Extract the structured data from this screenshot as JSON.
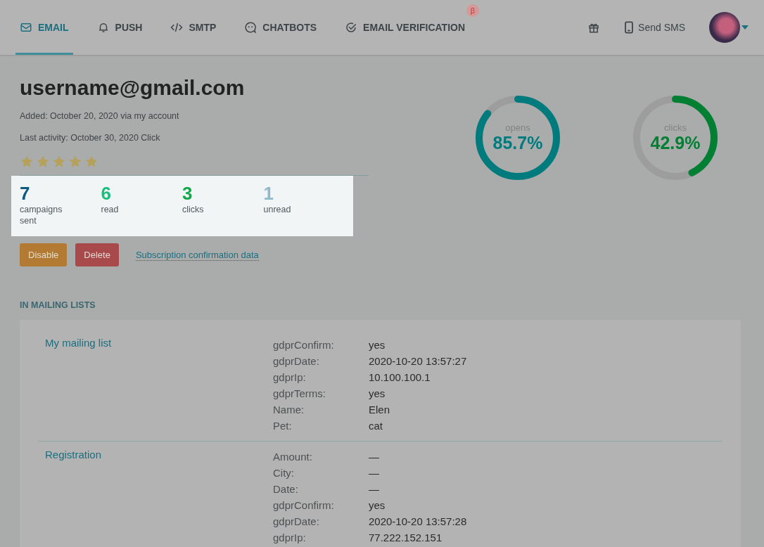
{
  "nav": {
    "tabs": [
      {
        "label": "EMAIL",
        "kind": "mail",
        "selected": true
      },
      {
        "label": "PUSH",
        "kind": "bell",
        "selected": false
      },
      {
        "label": "SMTP",
        "kind": "code",
        "selected": false
      },
      {
        "label": "CHATBOTS",
        "kind": "chat",
        "selected": false
      },
      {
        "label": "EMAIL VERIFICATION",
        "kind": "check",
        "selected": false,
        "badge": "β"
      }
    ],
    "send_sms": "Send SMS"
  },
  "contact": {
    "email": "username@gmail.com",
    "added": "Added: October 20, 2020 via my account",
    "last_activity": "Last activity: October 30, 2020 Click",
    "stars": 5
  },
  "stats": [
    {
      "value": "7",
      "label": "campaigns sent",
      "color": "#0b5a82"
    },
    {
      "value": "6",
      "label": "read",
      "color": "#17c07a"
    },
    {
      "value": "3",
      "label": "clicks",
      "color": "#12a84a"
    },
    {
      "value": "1",
      "label": "unread",
      "color": "#8fb8c8"
    }
  ],
  "actions": {
    "disable": "Disable",
    "delete": "Delete",
    "link": "Subscription confirmation data"
  },
  "gauges": [
    {
      "label": "opens",
      "value": "85.7%",
      "level": 0.857,
      "color": "#007b7d"
    },
    {
      "label": "clicks",
      "value": "42.9%",
      "level": 0.429,
      "color": "#017f33"
    }
  ],
  "mailing_lists": {
    "heading": "IN MAILING LISTS",
    "lists": [
      {
        "name": "My mailing list",
        "fields": [
          [
            "gdprConfirm:",
            "yes"
          ],
          [
            "gdprDate:",
            "2020-10-20 13:57:27"
          ],
          [
            "gdprIp:",
            "10.100.100.1"
          ],
          [
            "gdprTerms:",
            "yes"
          ],
          [
            "Name:",
            "Elen"
          ],
          [
            "Pet:",
            "cat"
          ]
        ]
      },
      {
        "name": "Registration",
        "fields": [
          [
            "Amount:",
            "—"
          ],
          [
            "City:",
            "—"
          ],
          [
            "Date:",
            "—"
          ],
          [
            "gdprConfirm:",
            "yes"
          ],
          [
            "gdprDate:",
            "2020-10-20 13:57:28"
          ],
          [
            "gdprIp:",
            "77.222.152.151"
          ]
        ]
      }
    ]
  }
}
